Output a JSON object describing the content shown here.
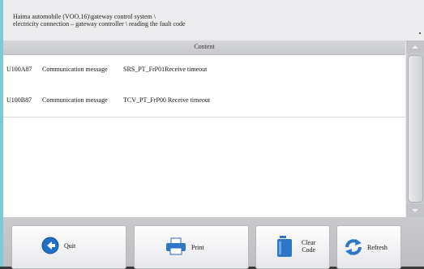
{
  "header": {
    "title": "Haima automobile (VOO.16)\\gateway control system \\\nelectricity connection – gateway controller \\ reading the fault code"
  },
  "table": {
    "column_header": "Content",
    "rows": [
      {
        "code": "U100A87",
        "type": "Communication message",
        "message": "SRS_PT_FrP01Receive timeout"
      },
      {
        "code": "U100B87",
        "type": "Communication message",
        "message": "TCV_PT_FrP00  Receive timeout"
      }
    ]
  },
  "toolbar": {
    "quit": {
      "label": "Quit",
      "icon": "back-arrow-icon"
    },
    "print": {
      "label": "Print",
      "icon": "printer-icon"
    },
    "clear": {
      "label": "Clear\nCode",
      "icon": "clear-code-icon"
    },
    "refresh": {
      "label": "Refresh",
      "icon": "refresh-icon"
    }
  },
  "colors": {
    "accent": "#1f6fc4",
    "left_edge": "#7fc8d6"
  }
}
